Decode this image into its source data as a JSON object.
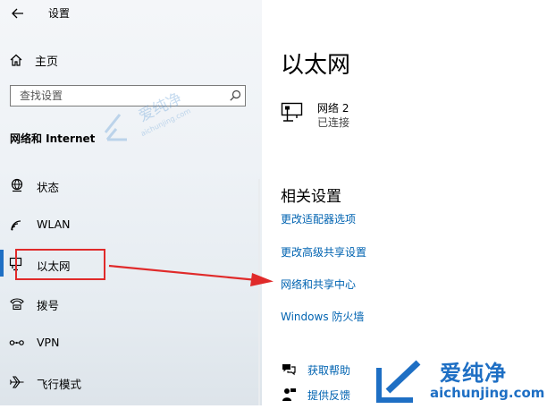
{
  "app": {
    "title": "设置"
  },
  "nav": {
    "home_label": "主页",
    "search_placeholder": "查找设置",
    "section_title": "网络和 Internet",
    "items": [
      {
        "label": "状态",
        "icon": "globe-status-icon"
      },
      {
        "label": "WLAN",
        "icon": "wifi-icon"
      },
      {
        "label": "以太网",
        "icon": "ethernet-icon",
        "selected": true
      },
      {
        "label": "拨号",
        "icon": "dialup-phone-icon"
      },
      {
        "label": "VPN",
        "icon": "vpn-icon"
      },
      {
        "label": "飞行模式",
        "icon": "airplane-icon"
      }
    ]
  },
  "main": {
    "title": "以太网",
    "network": {
      "name": "网络 2",
      "status": "已连接",
      "icon": "ethernet-monitor-icon"
    },
    "related_title": "相关设置",
    "links": [
      "更改适配器选项",
      "更改高级共享设置",
      "网络和共享中心",
      "Windows 防火墙"
    ],
    "help": [
      {
        "label": "获取帮助",
        "icon": "help-chat-icon"
      },
      {
        "label": "提供反馈",
        "icon": "feedback-person-icon"
      }
    ]
  },
  "watermark": {
    "name": "爱纯净",
    "url": "aichunjing.com"
  },
  "colors": {
    "accent": "#1e6fc4",
    "link": "#0063b1",
    "annotation": "#e02a2a"
  }
}
